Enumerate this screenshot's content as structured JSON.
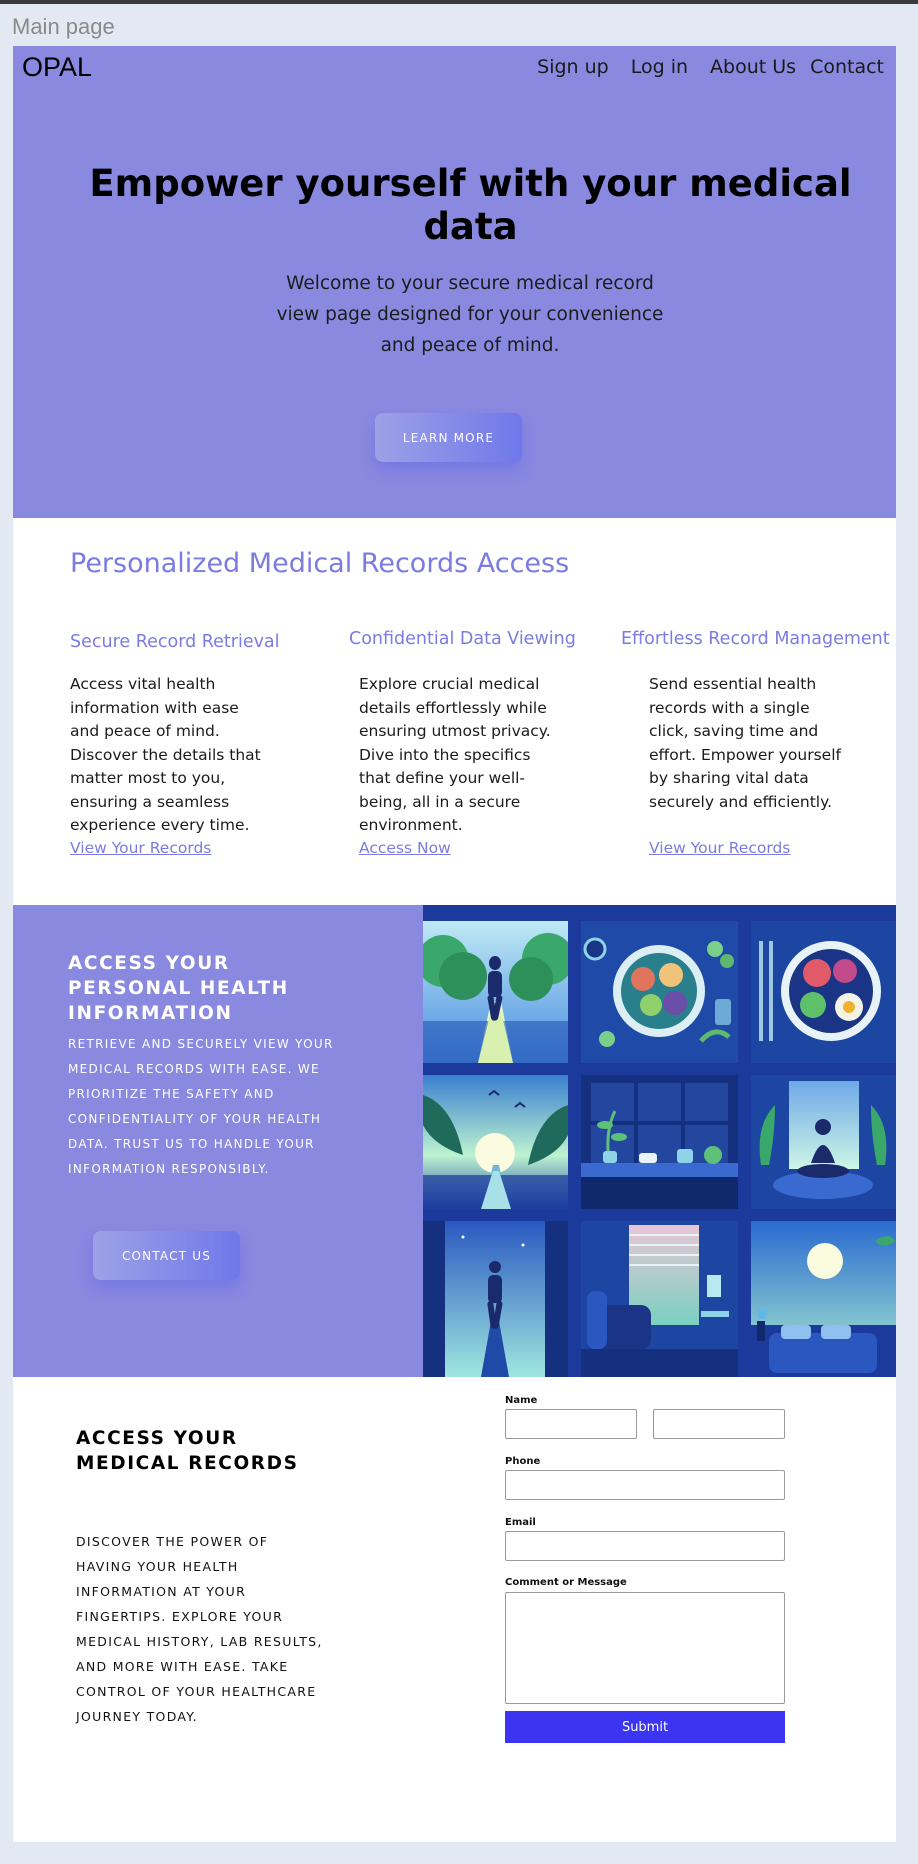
{
  "frame": {
    "label": "Main page"
  },
  "header": {
    "logo": "OPAL",
    "nav": [
      "Sign up",
      "Log in",
      "About Us",
      "Contact"
    ]
  },
  "hero": {
    "title": "Empower yourself with your medical data",
    "subtitle": "Welcome to your secure medical record view page designed for your convenience and peace of mind.",
    "button": "LEARN MORE"
  },
  "features": {
    "title": "Personalized Medical Records Access",
    "columns": [
      {
        "heading": "Secure Record Retrieval",
        "body": "Access vital health information with ease and peace of mind. Discover the details that matter most to you, ensuring a seamless experience every time.",
        "link": "View Your Records"
      },
      {
        "heading": "Confidential Data Viewing",
        "body": "Explore crucial medical details effortlessly while ensuring utmost privacy. Dive into the specifics that define your well-being, all in a secure environment.",
        "link": "Access Now"
      },
      {
        "heading": "Effortless Record Management",
        "body": "Send essential health records with a single click, saving time and effort. Empower yourself by sharing vital data securely and efficiently.",
        "link": "View Your Records"
      }
    ]
  },
  "band": {
    "title": "ACCESS YOUR PERSONAL HEALTH INFORMATION",
    "body": "RETRIEVE AND SECURELY VIEW YOUR MEDICAL RECORDS WITH EASE. WE PRIORITIZE THE SAFETY AND CONFIDENTIALITY OF YOUR HEALTH DATA. TRUST US TO HANDLE YOUR INFORMATION RESPONSIBLY.",
    "button": "CONTACT US"
  },
  "gallery": {
    "images": [
      "runner-park-image",
      "healthy-plate-image",
      "salad-plate-image",
      "sunrise-path-image",
      "window-plants-image",
      "meditation-image",
      "night-runner-image",
      "living-room-image",
      "bedroom-moon-image"
    ]
  },
  "form_section": {
    "title": "ACCESS YOUR MEDICAL RECORDS",
    "body": "DISCOVER THE POWER OF HAVING YOUR HEALTH INFORMATION AT YOUR FINGERTIPS. EXPLORE YOUR MEDICAL HISTORY, LAB RESULTS, AND MORE WITH EASE. TAKE CONTROL OF YOUR HEALTHCARE JOURNEY TODAY.",
    "labels": {
      "name": "Name",
      "phone": "Phone",
      "email": "Email",
      "message": "Comment or Message"
    },
    "values": {
      "first": "",
      "last": "",
      "phone": "",
      "email": "",
      "message": ""
    },
    "submit": "Submit"
  },
  "colors": {
    "accent": "#8a89e0",
    "heading": "#7b7be2",
    "submit": "#3b35f1",
    "gallery_bg": "#1b3a9c"
  }
}
